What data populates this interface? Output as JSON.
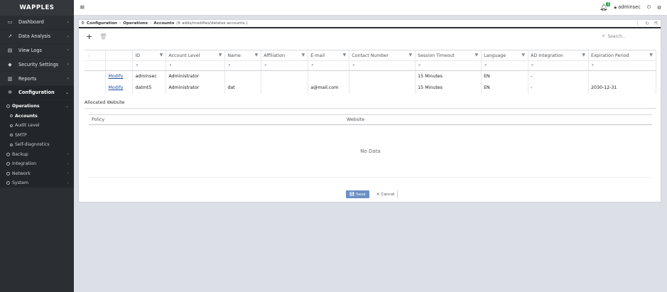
{
  "app": {
    "logo": "WAPPLES"
  },
  "sidebar": {
    "items": [
      {
        "label": "Dashboard",
        "icon": "monitor-icon"
      },
      {
        "label": "Data Analysis",
        "icon": "chart-icon"
      },
      {
        "label": "View Logs",
        "icon": "document-icon"
      },
      {
        "label": "Security Settings",
        "icon": "shield-icon"
      },
      {
        "label": "Reports",
        "icon": "bar-chart-icon"
      },
      {
        "label": "Configuration",
        "icon": "gear-icon"
      }
    ],
    "config_sub": [
      {
        "label": "Operations"
      },
      {
        "label": "Accounts"
      },
      {
        "label": "Audit Level"
      },
      {
        "label": "SMTP"
      },
      {
        "label": "Self-diagnostics"
      },
      {
        "label": "Backup"
      },
      {
        "label": "Integration"
      },
      {
        "label": "Network"
      },
      {
        "label": "System"
      }
    ]
  },
  "topbar": {
    "menu_icon": "≡",
    "notification_count": "1",
    "user": "adminsec"
  },
  "breadcrumb": {
    "root": "Configuration",
    "section": "Operations",
    "page": "Accounts",
    "note": "(It adds/modifies/deletes accounts.)"
  },
  "toolbar": {
    "add": "+",
    "search_placeholder": "Search..."
  },
  "table": {
    "columns": [
      "ID",
      "Account Level",
      "Name",
      "Affiliation",
      "E-mail",
      "Contact Number",
      "Session Timeout",
      "Language",
      "AD Integration",
      "Expiration Period"
    ],
    "rows": [
      {
        "action": "Modify",
        "id": "adminsec",
        "level": "Administrator",
        "name": "",
        "affiliation": "",
        "email": "",
        "contact": "",
        "timeout": "15 Minutes",
        "language": "EN",
        "ad": "-",
        "expiration": ""
      },
      {
        "action": "Modify",
        "id": "datmt5",
        "level": "Administrator",
        "name": "dat",
        "affiliation": "",
        "email": "a@mail.com",
        "contact": "",
        "timeout": "15 Minutes",
        "language": "EN",
        "ad": "-",
        "expiration": "2030-12-31"
      }
    ]
  },
  "allocated": {
    "title": "Allocated Website",
    "col_policy": "Policy",
    "col_website": "Website",
    "empty": "No Data"
  },
  "actions": {
    "save": "Save",
    "cancel": "Cancel"
  }
}
